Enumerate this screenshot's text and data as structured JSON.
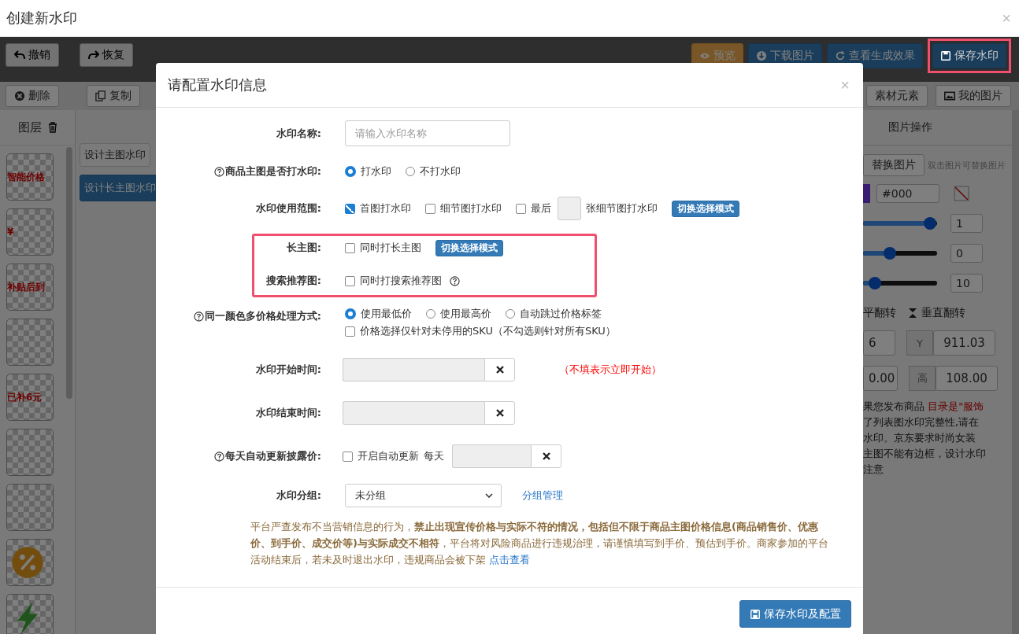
{
  "window": {
    "title": "创建新水印",
    "close": "×"
  },
  "toolbar": {
    "left": [
      {
        "label": "撤销"
      },
      {
        "label": "恢复"
      }
    ],
    "right": [
      {
        "label": "预览",
        "kind": "warning",
        "highlighted": false
      },
      {
        "label": "下载图片",
        "kind": "primary",
        "highlighted": false
      },
      {
        "label": "查看生成效果",
        "kind": "primary",
        "highlighted": false
      },
      {
        "label": "保存水印",
        "kind": "primary",
        "highlighted": true
      }
    ]
  },
  "toolbar2": {
    "left": [
      {
        "label": "删除"
      },
      {
        "label": "复制"
      }
    ],
    "right": [
      {
        "label": "素材元素"
      },
      {
        "label": "我的图片"
      }
    ]
  },
  "layers": {
    "title": "图层",
    "items": [
      {
        "kind": "text",
        "text": "智能价格"
      },
      {
        "kind": "text",
        "text": "¥"
      },
      {
        "kind": "text",
        "text": "补贴后到"
      },
      {
        "kind": "blank"
      },
      {
        "kind": "text",
        "text": "已补6元"
      },
      {
        "kind": "blank"
      },
      {
        "kind": "blank"
      },
      {
        "kind": "percent"
      },
      {
        "kind": "bolt"
      }
    ]
  },
  "design_tabs": [
    {
      "label": "设计主图水印",
      "selected": false
    },
    {
      "label": "设计长主图水印",
      "selected": true
    }
  ],
  "image_panel": {
    "title": "图片操作",
    "replace_button": "替换图片",
    "replace_hint": "双击图片可替换图片",
    "color": "#3a1b72",
    "color_value": "#000",
    "sliders": [
      {
        "level": 0.9,
        "value": "1"
      },
      {
        "level": 0.36,
        "value": "0"
      },
      {
        "level": 0.16,
        "value": "10"
      }
    ],
    "flip": [
      {
        "label": "平翻转"
      },
      {
        "label": "垂直翻转"
      }
    ],
    "x_value": "6",
    "y_label": "Y",
    "y_value": "911.03",
    "w_value": "0.00",
    "h_label": "高",
    "h_value": "108.00",
    "note": [
      {
        "text": "果您发布商品 ",
        "em": "目录是\"服饰"
      },
      {
        "text": "了列表图水印完整性,请在"
      },
      {
        "text": "水印。京东要求时尚女装"
      },
      {
        "text": "主图不能有边框，设计水印"
      },
      {
        "text": "注意"
      }
    ]
  },
  "dialog": {
    "title": "请配置水印信息",
    "close": "×",
    "name": {
      "label": "水印名称:",
      "placeholder": "请输入水印名称"
    },
    "main_image": {
      "label": "商品主图是否打水印:",
      "help": true,
      "options": [
        {
          "label": "打水印",
          "selected": true
        },
        {
          "label": "不打水印",
          "selected": false
        }
      ]
    },
    "scope": {
      "label": "水印使用范围:",
      "first": {
        "label": "首图打水印",
        "checked": true
      },
      "detail": {
        "label": "细节图打水印",
        "checked": false
      },
      "last": {
        "label": "最后",
        "checked": false,
        "suffix": "张细节图打水印"
      },
      "button": "切换选择模式"
    },
    "extra": {
      "highlighted": true,
      "long_image": {
        "label": "长主图:",
        "checkbox": {
          "label": "同时打长主图",
          "checked": false
        },
        "button": "切换选择模式"
      },
      "search_image": {
        "label": "搜索推荐图:",
        "checkbox": {
          "label": "同时打搜索推荐图",
          "checked": false
        },
        "help": true
      }
    },
    "multi_price": {
      "label": "同一颜色多价格处理方式:",
      "help": true,
      "options": [
        {
          "label": "使用最低价",
          "selected": true
        },
        {
          "label": "使用最高价",
          "selected": false
        },
        {
          "label": "自动跳过价格标签",
          "selected": false
        }
      ],
      "sku_only": {
        "label": "价格选择仅针对未停用的SKU（不勾选则针对所有SKU）",
        "checked": false
      }
    },
    "start_time": {
      "label": "水印开始时间:",
      "hint": "（不填表示立即开始）"
    },
    "end_time": {
      "label": "水印结束时间:"
    },
    "auto_update": {
      "label": "每天自动更新披露价:",
      "help": true,
      "checkbox": {
        "label": "开启自动更新",
        "checked": false
      },
      "daily": "每天"
    },
    "group": {
      "label": "水印分组:",
      "value": "未分组",
      "link": "分组管理"
    },
    "notice": {
      "text": "平台严查发布不当营销信息的行为，**禁止出现宣传价格与实际不符的情况，包括但不限于商品主图价格信息(商品销售价、优惠价、到手价、成交价等)与实际成交不相符**，平台将对风险商品进行违规治理，请谨慎填写到手价、预估到手价。商家参加的平台活动结束后，若未及时退出水印，违规商品会被下架 ",
      "link": "点击查看"
    },
    "submit": "保存水印及配置"
  }
}
